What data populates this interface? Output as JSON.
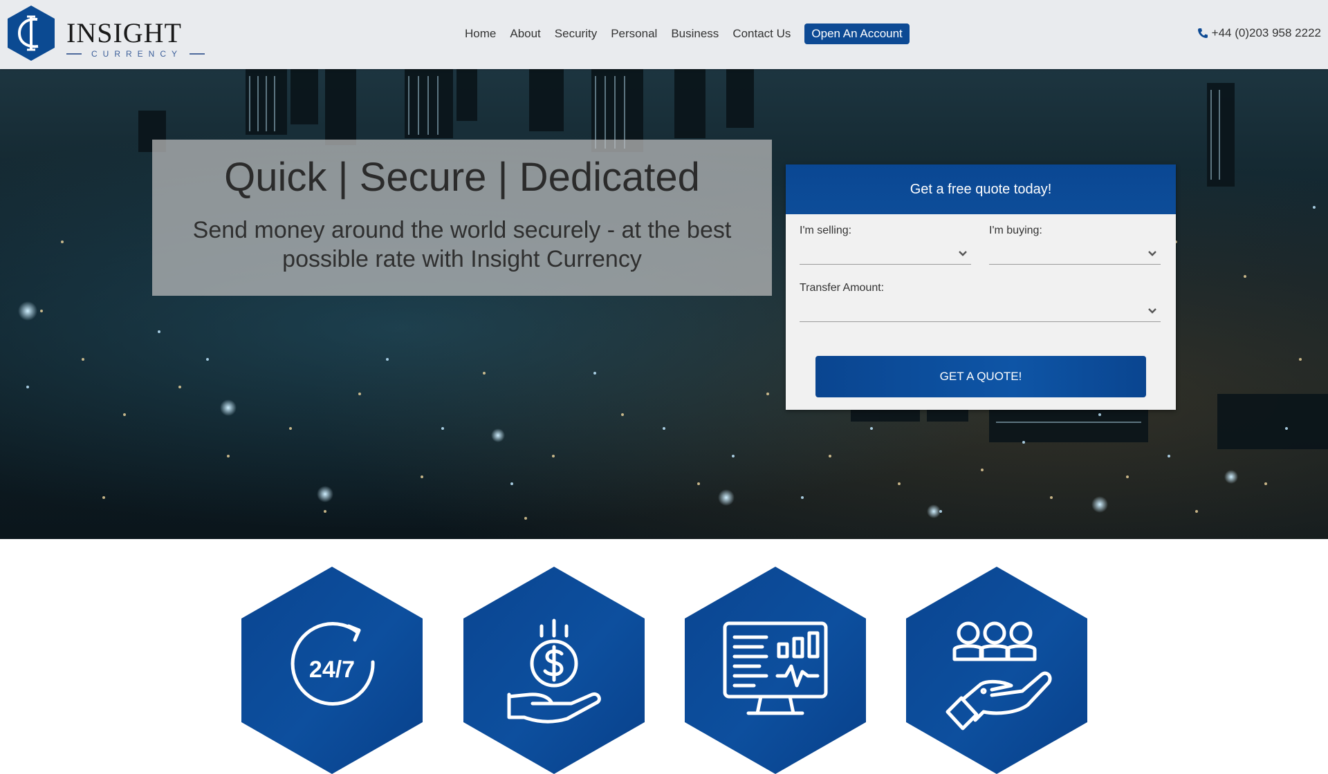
{
  "header": {
    "brand_name": "INSIGHT",
    "brand_sub": "CURRENCY",
    "nav": [
      "Home",
      "About",
      "Security",
      "Personal",
      "Business",
      "Contact Us"
    ],
    "cta": "Open An Account",
    "phone": "+44 (0)203 958 2222"
  },
  "hero": {
    "headline": "Quick | Secure | Dedicated",
    "subhead": "Send money around the world securely - at the best possible rate with Insight Currency"
  },
  "quote": {
    "title": "Get a free quote today!",
    "selling_label": "I'm selling:",
    "buying_label": "I'm buying:",
    "amount_label": "Transfer Amount:",
    "button": "GET A QUOTE!"
  },
  "features": {
    "support_icon_text": "24/7"
  },
  "colors": {
    "brand_blue": "#0d4a94",
    "header_bg": "#e9ebee"
  }
}
